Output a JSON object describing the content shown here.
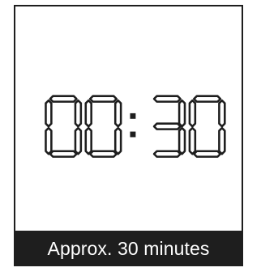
{
  "timer": {
    "value": "00:30",
    "digits": [
      "0",
      "0",
      "3",
      "0"
    ],
    "separator": ":"
  },
  "footer": {
    "label": "Approx. 30 minutes"
  },
  "colors": {
    "segment": "#1e1e1e",
    "background": "#ffffff",
    "footer_bg": "#1e1e1e",
    "footer_text": "#ffffff"
  }
}
